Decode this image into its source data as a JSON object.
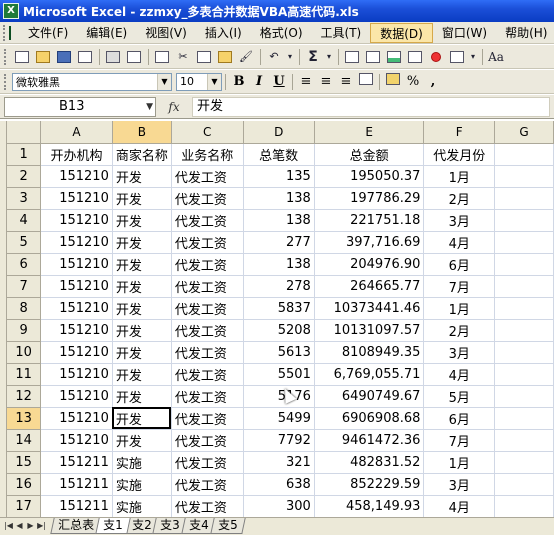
{
  "window": {
    "title": "Microsoft Excel - zzmxy_多表合并数据VBA高速代码.xls"
  },
  "menubar": {
    "items": [
      "文件(F)",
      "编辑(E)",
      "视图(V)",
      "插入(I)",
      "格式(O)",
      "工具(T)",
      "数据(D)",
      "窗口(W)",
      "帮助(H)"
    ],
    "highlighted": "数据(D)"
  },
  "toolbar": {
    "zoom_symbol": "Σ",
    "font_name": "微软雅黑",
    "font_size": "10",
    "bold": "B",
    "italic": "I",
    "underline": "U",
    "percent": "%",
    "comma": ",",
    "aa": "Aa"
  },
  "formula_bar": {
    "cell_ref": "B13",
    "fx": "fx",
    "value": "开发"
  },
  "grid": {
    "columns": [
      "A",
      "B",
      "C",
      "D",
      "E",
      "F",
      "G"
    ],
    "selected_column": "B",
    "selected_row": "13",
    "active_cell": "B13",
    "rows": [
      {
        "n": "1",
        "cells": [
          "开办机构",
          "商家名称",
          "业务名称",
          "总笔数",
          "总金额",
          "代发月份",
          ""
        ]
      },
      {
        "n": "2",
        "cells": [
          "151210",
          "开发",
          "代发工资",
          "135",
          "195050.37",
          "1月",
          ""
        ]
      },
      {
        "n": "3",
        "cells": [
          "151210",
          "开发",
          "代发工资",
          "138",
          "197786.29",
          "2月",
          ""
        ]
      },
      {
        "n": "4",
        "cells": [
          "151210",
          "开发",
          "代发工资",
          "138",
          "221751.18",
          "3月",
          ""
        ]
      },
      {
        "n": "5",
        "cells": [
          "151210",
          "开发",
          "代发工资",
          "277",
          "397,716.69",
          "4月",
          ""
        ]
      },
      {
        "n": "6",
        "cells": [
          "151210",
          "开发",
          "代发工资",
          "138",
          "204976.90",
          "6月",
          ""
        ]
      },
      {
        "n": "7",
        "cells": [
          "151210",
          "开发",
          "代发工资",
          "278",
          "264665.77",
          "7月",
          ""
        ]
      },
      {
        "n": "8",
        "cells": [
          "151210",
          "开发",
          "代发工资",
          "5837",
          "10373441.46",
          "1月",
          ""
        ]
      },
      {
        "n": "9",
        "cells": [
          "151210",
          "开发",
          "代发工资",
          "5208",
          "10131097.57",
          "2月",
          ""
        ]
      },
      {
        "n": "10",
        "cells": [
          "151210",
          "开发",
          "代发工资",
          "5613",
          "8108949.35",
          "3月",
          ""
        ]
      },
      {
        "n": "11",
        "cells": [
          "151210",
          "开发",
          "代发工资",
          "5501",
          "6,769,055.71",
          "4月",
          ""
        ]
      },
      {
        "n": "12",
        "cells": [
          "151210",
          "开发",
          "代发工资",
          "5176",
          "6490749.67",
          "5月",
          ""
        ]
      },
      {
        "n": "13",
        "cells": [
          "151210",
          "开发",
          "代发工资",
          "5499",
          "6906908.68",
          "6月",
          ""
        ]
      },
      {
        "n": "14",
        "cells": [
          "151210",
          "开发",
          "代发工资",
          "7792",
          "9461472.36",
          "7月",
          ""
        ]
      },
      {
        "n": "15",
        "cells": [
          "151211",
          "实施",
          "代发工资",
          "321",
          "482831.52",
          "1月",
          ""
        ]
      },
      {
        "n": "16",
        "cells": [
          "151211",
          "实施",
          "代发工资",
          "638",
          "852229.59",
          "3月",
          ""
        ]
      },
      {
        "n": "17",
        "cells": [
          "151211",
          "实施",
          "代发工资",
          "300",
          "458,149.93",
          "4月",
          ""
        ]
      }
    ]
  },
  "sheet_tabs": {
    "nav": [
      "|◀",
      "◀",
      "▶",
      "▶|"
    ],
    "tabs": [
      "汇总表",
      "支1",
      "支2",
      "支3",
      "支4",
      "支5"
    ],
    "active": "支1"
  }
}
